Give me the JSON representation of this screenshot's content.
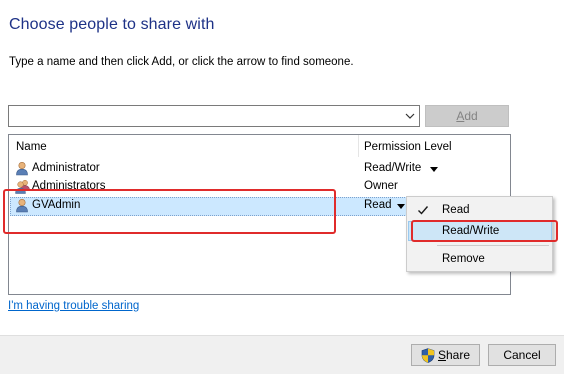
{
  "dialog": {
    "heading": "Choose people to share with",
    "instructions": "Type a name and then click Add, or click the arrow to find someone."
  },
  "name_combo": {
    "value": "",
    "icon": "chevron-down-icon"
  },
  "add_button": {
    "label_underline": "A",
    "label_rest": "dd",
    "enabled": false
  },
  "list": {
    "columns": [
      "Name",
      "Permission Level"
    ],
    "rows": [
      {
        "name": "Administrator",
        "permission": "Read/Write",
        "has_dropdown": true,
        "icon": "user-icon",
        "selected": false
      },
      {
        "name": "Administrators",
        "permission": "Owner",
        "has_dropdown": false,
        "icon": "group-icon",
        "selected": false
      },
      {
        "name": "GVAdmin",
        "permission": "Read",
        "has_dropdown": true,
        "icon": "user-icon",
        "selected": true
      }
    ]
  },
  "permission_menu": {
    "items": [
      {
        "label": "Read",
        "checked": true,
        "hovered": false
      },
      {
        "label": "Read/Write",
        "checked": false,
        "hovered": true
      },
      {
        "label": "Remove",
        "checked": false,
        "hovered": false
      }
    ]
  },
  "trouble_link": "I'm having trouble sharing",
  "buttons": {
    "share_underline": "S",
    "share_rest": "hare",
    "cancel": "Cancel"
  },
  "colors": {
    "heading": "#1e3287",
    "link": "#0066cc",
    "selection": "#cce8ff",
    "menu_hover": "#cde6f7",
    "highlight_annotation": "#e02b2b"
  }
}
